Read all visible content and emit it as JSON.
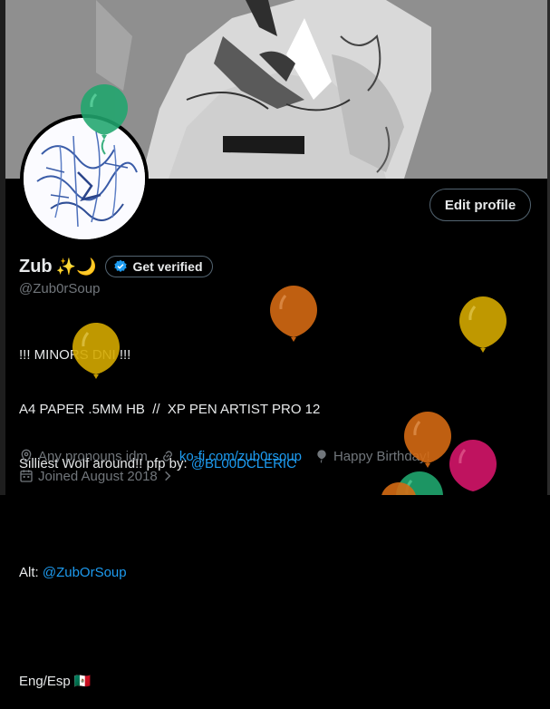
{
  "profile": {
    "display_name": "Zub",
    "name_emoji": "✨🌙",
    "verify_label": "Get verified",
    "handle": "@Zub0rSoup",
    "edit_label": "Edit profile"
  },
  "bio": {
    "line1": "!!! MINORS DNI !!!",
    "line2": "A4 PAPER .5MM HB  //  XP PEN ARTIST PRO 12",
    "line3_text": "Silliest Wolf around!! pfp by: ",
    "line3_link": "@BL00DCLERIC",
    "line5_text": "Alt: ",
    "line5_link": "@ZubOrSoup",
    "line7_text": "Eng/Esp ",
    "line7_flag": "🇲🇽"
  },
  "meta": {
    "pronouns": "Any pronouns idm",
    "website": "ko-fi.com/zub0rsoup",
    "birthday": "Happy Birthday!",
    "joined": "Joined August 2018"
  },
  "icons": {
    "location": "location-pin-icon",
    "link": "link-icon",
    "birthday": "balloon-icon",
    "calendar": "calendar-icon",
    "verified": "verified-badge-icon"
  },
  "colors": {
    "accent": "#1d9bf0",
    "text_primary": "#e7e9ea",
    "text_secondary": "#71767b",
    "balloon_green": "#20a66e",
    "balloon_orange": "#d46a13",
    "balloon_yellow": "#d4a900",
    "balloon_pink": "#d4166a"
  }
}
